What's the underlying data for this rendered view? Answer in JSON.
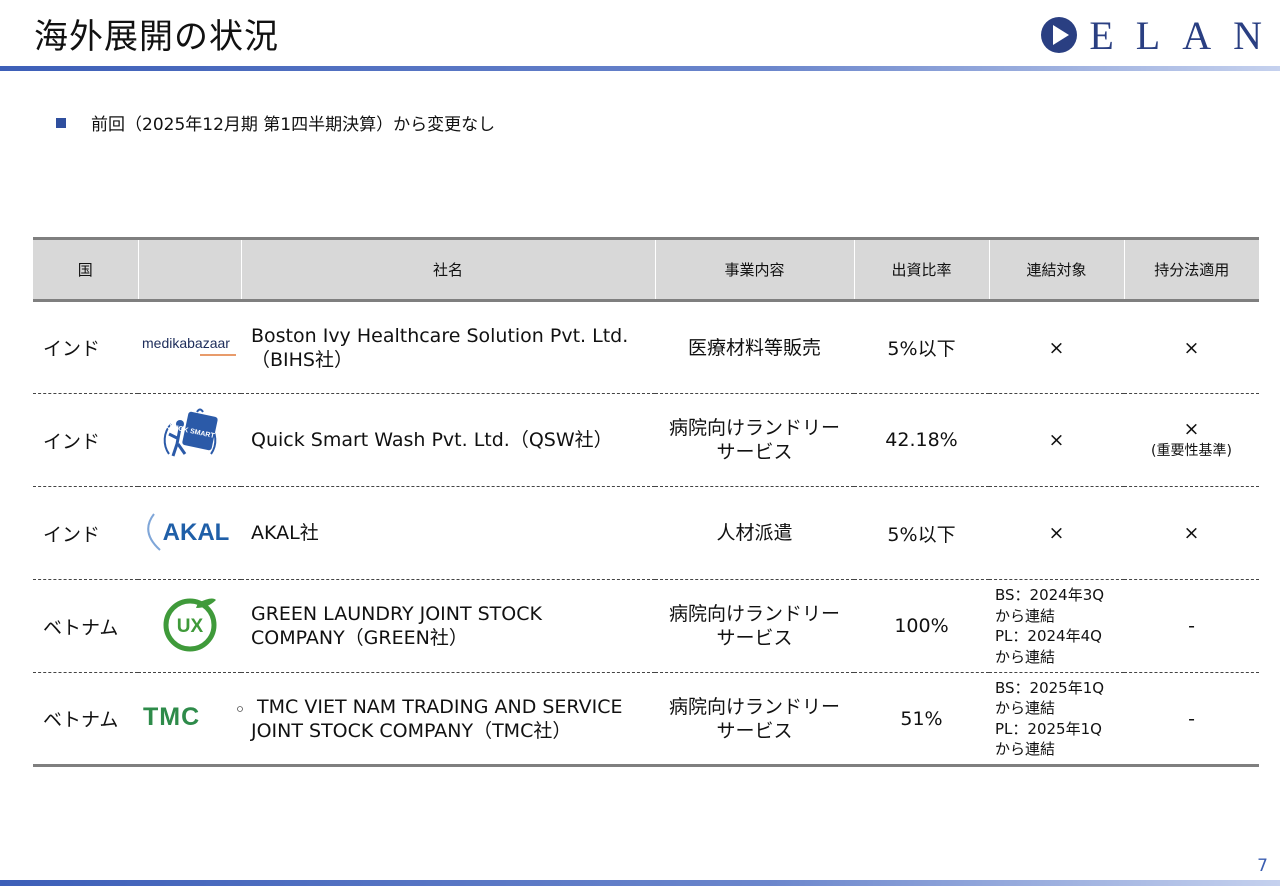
{
  "page": {
    "title": "海外展開の状況",
    "brand": "ELAN",
    "bullet": "前回（2025年12月期 第1四半期決算）から変更なし",
    "page_number": "7"
  },
  "colors": {
    "accent": "#2f4f9e",
    "header_bg": "#d8d8d8"
  },
  "table": {
    "headers": [
      "国",
      "",
      "社名",
      "事業内容",
      "出資比率",
      "連結対象",
      "持分法適用"
    ],
    "rows": [
      {
        "country": "インド",
        "logo": "medikabazaar-logo",
        "logo_text": "medikabazaar",
        "name_line1": "Boston Ivy Healthcare Solution Pvt. Ltd.",
        "name_line2": "（BIHS社）",
        "business_line1": "医療材料等販売",
        "business_line2": "",
        "ratio": "5%以下",
        "consolidated_line1": "×",
        "consolidated_line2": "",
        "consolidated_line3": "",
        "consolidated_line4": "",
        "equity": "×",
        "equity_note": ""
      },
      {
        "country": "インド",
        "logo": "quick-smart-wash-logo",
        "logo_text": "QUICK SMART WASH",
        "name_line1": "Quick Smart Wash Pvt. Ltd.（QSW社）",
        "name_line2": "",
        "business_line1": "病院向けランドリー",
        "business_line2": "サービス",
        "ratio": "42.18%",
        "consolidated_line1": "×",
        "consolidated_line2": "",
        "consolidated_line3": "",
        "consolidated_line4": "",
        "equity": "×",
        "equity_note": "(重要性基準)"
      },
      {
        "country": "インド",
        "logo": "akal-logo",
        "logo_text": "AKAL",
        "name_line1": "AKAL社",
        "name_line2": "",
        "business_line1": "人材派遣",
        "business_line2": "",
        "ratio": "5%以下",
        "consolidated_line1": "×",
        "consolidated_line2": "",
        "consolidated_line3": "",
        "consolidated_line4": "",
        "equity": "×",
        "equity_note": ""
      },
      {
        "country": "ベトナム",
        "logo": "green-laundry-logo",
        "logo_text": "UX",
        "name_line1": "GREEN LAUNDRY JOINT STOCK",
        "name_line2": "COMPANY（GREEN社）",
        "business_line1": "病院向けランドリー",
        "business_line2": "サービス",
        "ratio": "100%",
        "consolidated_line1": "BS：2024年3Q",
        "consolidated_line2": "から連結",
        "consolidated_line3": "PL：2024年4Q",
        "consolidated_line4": "から連結",
        "equity": "-",
        "equity_note": ""
      },
      {
        "country": "ベトナム",
        "logo": "tmc-logo",
        "logo_text": "TMC",
        "name_line1": " TMC VIET NAM TRADING AND SERVICE",
        "name_line2": "JOINT STOCK COMPANY（TMC社）",
        "business_line1": "病院向けランドリー",
        "business_line2": "サービス",
        "ratio": "51%",
        "consolidated_line1": "BS：2025年1Q",
        "consolidated_line2": "から連結",
        "consolidated_line3": "PL：2025年1Q",
        "consolidated_line4": "から連結",
        "equity": "-",
        "equity_note": ""
      }
    ]
  }
}
